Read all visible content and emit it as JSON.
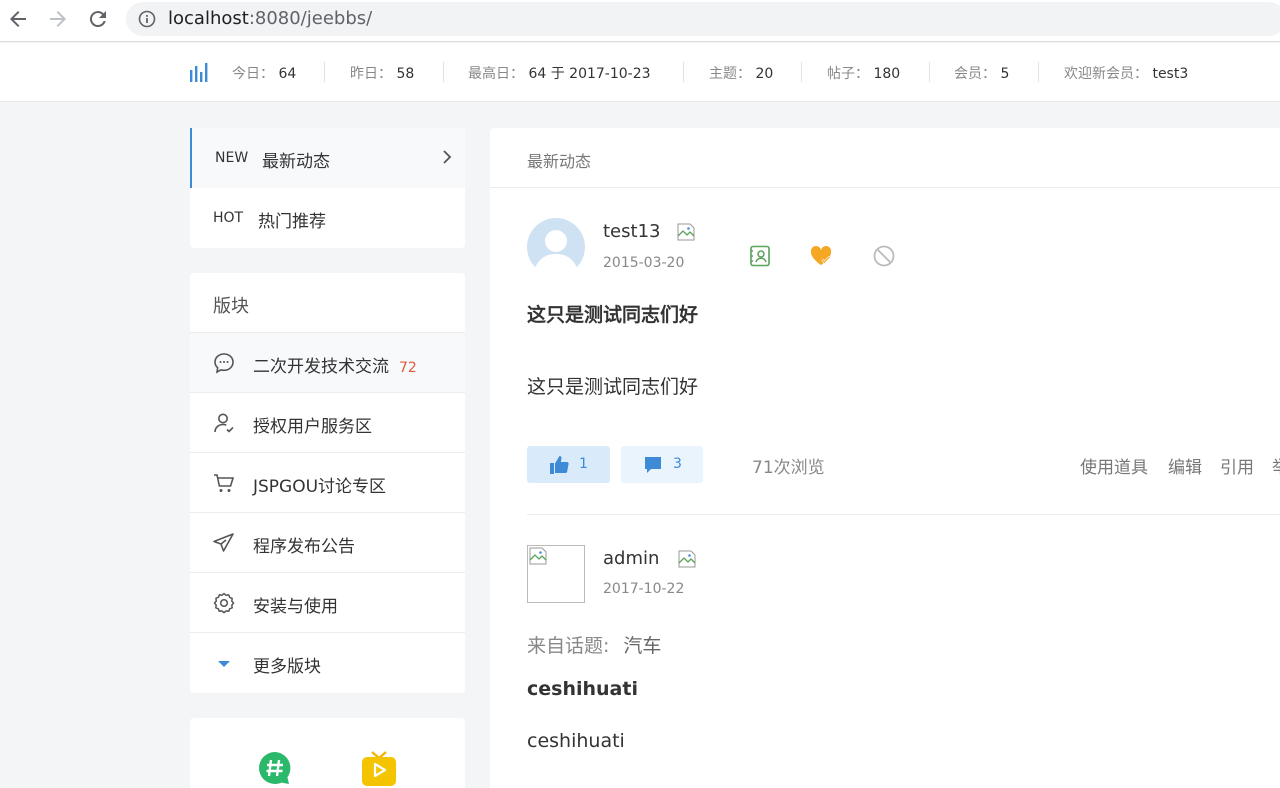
{
  "browser": {
    "url_host": "localhost",
    "url_rest": ":8080/jeebbs/"
  },
  "stats": {
    "today_label": "今日：",
    "today": "64",
    "yesterday_label": "昨日：",
    "yesterday": "58",
    "peak_label": "最高日：",
    "peak": "64 于 2017-10-23",
    "topics_label": "主题：",
    "topics": "20",
    "posts_label": "帖子：",
    "posts": "180",
    "members_label": "会员：",
    "members": "5",
    "welcome_label": "欢迎新会员：",
    "welcome": "test3"
  },
  "nav": {
    "items": [
      {
        "tag": "NEW",
        "label": "最新动态"
      },
      {
        "tag": "HOT",
        "label": "热门推荐"
      }
    ]
  },
  "boards": {
    "title": "版块",
    "items": [
      {
        "label": "二次开发技术交流",
        "count": "72",
        "icon": "chat-bubble-icon"
      },
      {
        "label": "授权用户服务区",
        "count": "",
        "icon": "user-check-icon"
      },
      {
        "label": "JSPGOU讨论专区",
        "count": "",
        "icon": "cart-icon"
      },
      {
        "label": "程序发布公告",
        "count": "",
        "icon": "paper-plane-icon"
      },
      {
        "label": "安装与使用",
        "count": "",
        "icon": "gear-icon"
      }
    ],
    "more": "更多版块"
  },
  "main": {
    "title": "最新动态",
    "post1": {
      "user": "test13",
      "date": "2015-03-20",
      "title": "这只是测试同志们好",
      "body": "这只是测试同志们好",
      "likes": "1",
      "comments": "3",
      "views": "71次浏览",
      "tools": [
        "使用道具",
        "编辑",
        "引用",
        "举"
      ]
    },
    "post2": {
      "user": "admin",
      "date": "2017-10-22",
      "from_label": "来自话题:",
      "from_topic": "汽车",
      "title": "ceshihuati",
      "body": "ceshihuati"
    }
  },
  "colors": {
    "accent": "#3d8ad6",
    "count": "#e05a3a"
  }
}
